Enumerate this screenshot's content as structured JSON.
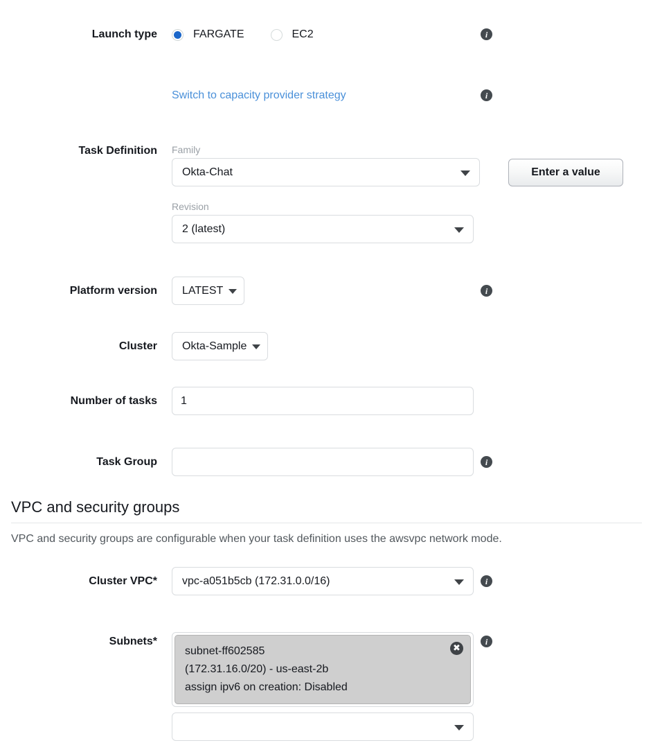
{
  "launch_type": {
    "label": "Launch type",
    "options": [
      {
        "value": "FARGATE",
        "selected": true
      },
      {
        "value": "EC2",
        "selected": false
      }
    ],
    "info": "info-icon"
  },
  "capacity_provider": {
    "link_label": "Switch to capacity provider strategy",
    "info": "info-icon"
  },
  "task_definition": {
    "label": "Task Definition",
    "family": {
      "sub_label": "Family",
      "value": "Okta-Chat"
    },
    "revision": {
      "sub_label": "Revision",
      "value": "2 (latest)"
    },
    "enter_value_button": "Enter a value"
  },
  "platform_version": {
    "label": "Platform version",
    "value": "LATEST",
    "info": "info-icon"
  },
  "cluster": {
    "label": "Cluster",
    "value": "Okta-Sample"
  },
  "number_of_tasks": {
    "label": "Number of tasks",
    "value": "1"
  },
  "task_group": {
    "label": "Task Group",
    "value": "",
    "info": "info-icon"
  },
  "vpc_section": {
    "title": "VPC and security groups",
    "description": "VPC and security groups are configurable when your task definition uses the awsvpc network mode."
  },
  "cluster_vpc": {
    "label": "Cluster VPC*",
    "value": "vpc-a051b5cb (172.31.0.0/16)",
    "info": "info-icon"
  },
  "subnets": {
    "label": "Subnets*",
    "info": "info-icon",
    "tokens": [
      {
        "line1": "subnet-ff602585",
        "line2": "(172.31.16.0/20) - us-east-2b",
        "line3": "assign ipv6 on creation: Disabled",
        "remove_icon": "✖"
      }
    ],
    "picker_value": ""
  },
  "colors": {
    "accent_blue": "#1b66c9",
    "link_blue": "#4a90d9",
    "text": "#16191f",
    "muted": "#9aa0a6",
    "border": "#d9dcdf",
    "token_bg": "#cfcfcf"
  }
}
